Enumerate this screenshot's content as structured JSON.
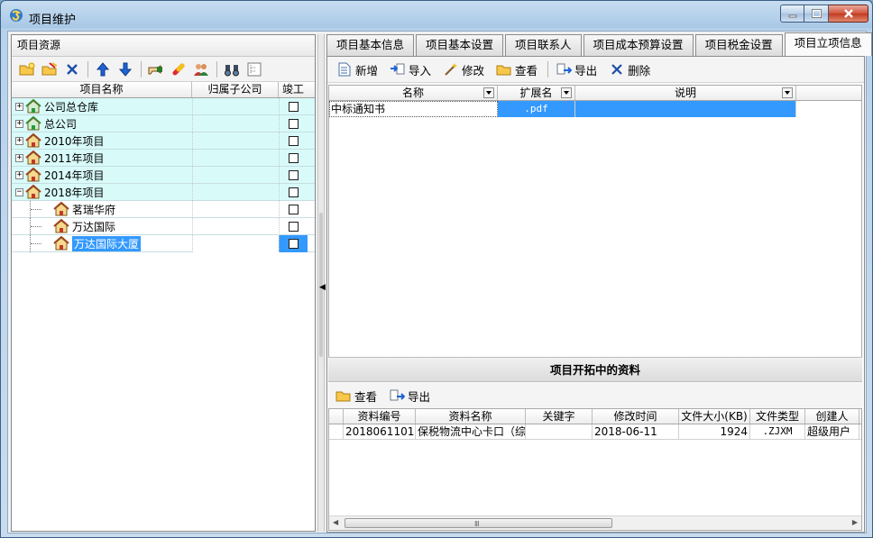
{
  "window": {
    "title": "项目维护"
  },
  "left_panel": {
    "header": "项目资源",
    "columns": [
      "项目名称",
      "归属子公司",
      "竣工"
    ],
    "toolbar_icons": [
      "folder-open-icon",
      "folder-edit-icon",
      "delete-icon",
      "move-up-icon",
      "move-down-icon",
      "hand-icon",
      "pill-icon",
      "users-icon",
      "binoculars-icon",
      "tree-view-icon"
    ],
    "tree": [
      {
        "label": "公司总仓库",
        "expander": "+",
        "level": 0,
        "teal": true,
        "icon": "warehouse-icon"
      },
      {
        "label": "总公司",
        "expander": "+",
        "level": 0,
        "teal": true,
        "icon": "warehouse-icon"
      },
      {
        "label": "2010年项目",
        "expander": "+",
        "level": 0,
        "teal": true,
        "icon": "house-icon"
      },
      {
        "label": "2011年项目",
        "expander": "+",
        "level": 0,
        "teal": true,
        "icon": "house-icon"
      },
      {
        "label": "2014年项目",
        "expander": "+",
        "level": 0,
        "teal": true,
        "icon": "house-icon"
      },
      {
        "label": "2018年项目",
        "expander": "−",
        "level": 0,
        "teal": true,
        "icon": "house-icon"
      },
      {
        "label": "茗瑞华府",
        "expander": "",
        "level": 1,
        "teal": false,
        "icon": "house-icon"
      },
      {
        "label": "万达国际",
        "expander": "",
        "level": 1,
        "teal": false,
        "icon": "house-icon"
      },
      {
        "label": "万达国际大厦",
        "expander": "",
        "level": 1,
        "teal": false,
        "selected": true,
        "icon": "house-icon"
      }
    ]
  },
  "tabs": [
    "项目基本信息",
    "项目基本设置",
    "项目联系人",
    "项目成本预算设置",
    "项目税金设置",
    "项目立项信息"
  ],
  "active_tab": 5,
  "top_toolbar": {
    "new": "新增",
    "import": "导入",
    "edit": "修改",
    "view": "查看",
    "export": "导出",
    "delete": "删除"
  },
  "grid1": {
    "columns": [
      "名称",
      "扩展名",
      "说明"
    ],
    "rows": [
      {
        "name": "中标通知书",
        "ext": ".pdf",
        "desc": ""
      }
    ]
  },
  "section2": {
    "title": "项目开拓中的资料",
    "toolbar": {
      "view": "查看",
      "export": "导出"
    },
    "columns": [
      "资料编号",
      "资料名称",
      "关键字",
      "修改时间",
      "文件大小(KB)",
      "文件类型",
      "创建人"
    ],
    "rows": [
      {
        "id": "2018061101",
        "name": "保税物流中心卡口（综",
        "keyword": "",
        "modified": "2018-06-11",
        "size": "1924",
        "type": ".ZJXM",
        "creator": "超级用户"
      }
    ],
    "scroll_grip": "Ⅲ"
  },
  "colors": {
    "selection": "#3399ff",
    "tree_teal": "#d8fbfa"
  }
}
